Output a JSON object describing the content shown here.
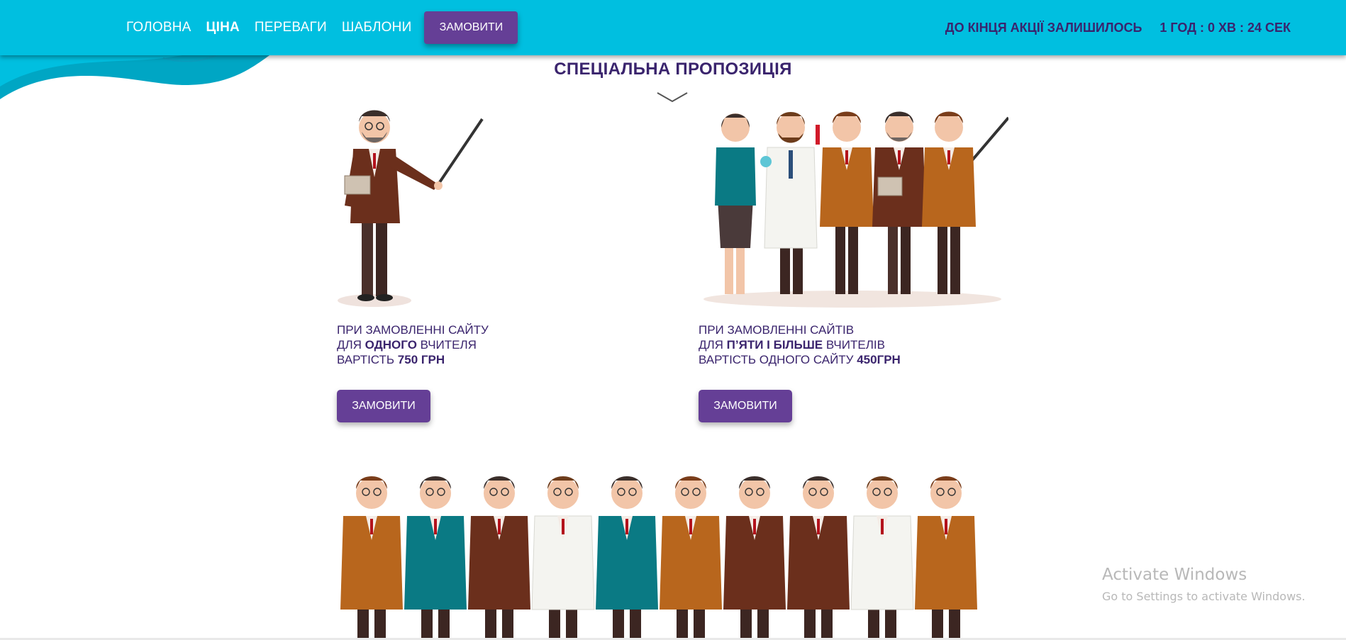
{
  "header": {
    "nav": [
      {
        "label": "ГОЛОВНА",
        "active": false
      },
      {
        "label": "ЦІНА",
        "active": true
      },
      {
        "label": "ПЕРЕВАГИ",
        "active": false
      },
      {
        "label": "ШАБЛОНИ",
        "active": false
      }
    ],
    "order_label": "ЗАМОВИТИ",
    "timer": {
      "label": "ДО КІНЦЯ АКЦІЇ ЗАЛИШИЛОСЬ",
      "value": "1 ГОД : 0 ХВ : 24 СЕК"
    }
  },
  "section": {
    "title": "СПЕЦІАЛЬНА ПРОПОЗИЦІЯ"
  },
  "offers": [
    {
      "line1": "ПРИ ЗАМОВЛЕННІ САЙТУ",
      "line2_pre": "ДЛЯ ",
      "line2_bold": "ОДНОГО",
      "line2_post": " ВЧИТЕЛЯ",
      "line3_pre": "ВАРТІСТЬ ",
      "line3_bold": "750 ГРН",
      "button": "ЗАМОВИТИ"
    },
    {
      "line1": "ПРИ ЗАМОВЛЕННІ САЙТІВ",
      "line2_pre": "ДЛЯ ",
      "line2_bold": "П’ЯТИ І БІЛЬШЕ",
      "line2_post": " ВЧИТЕЛІВ",
      "line3_pre": "ВАРТІСТЬ ОДНОГО САЙТУ ",
      "line3_bold": "450ГРН",
      "button": "ЗАМОВИТИ"
    }
  ],
  "watermark": {
    "title": "Activate Windows",
    "subtitle": "Go to Settings to activate Windows."
  },
  "colors": {
    "header_bg": "#00bfe0",
    "accent": "#653f96",
    "text": "#3a246d"
  }
}
